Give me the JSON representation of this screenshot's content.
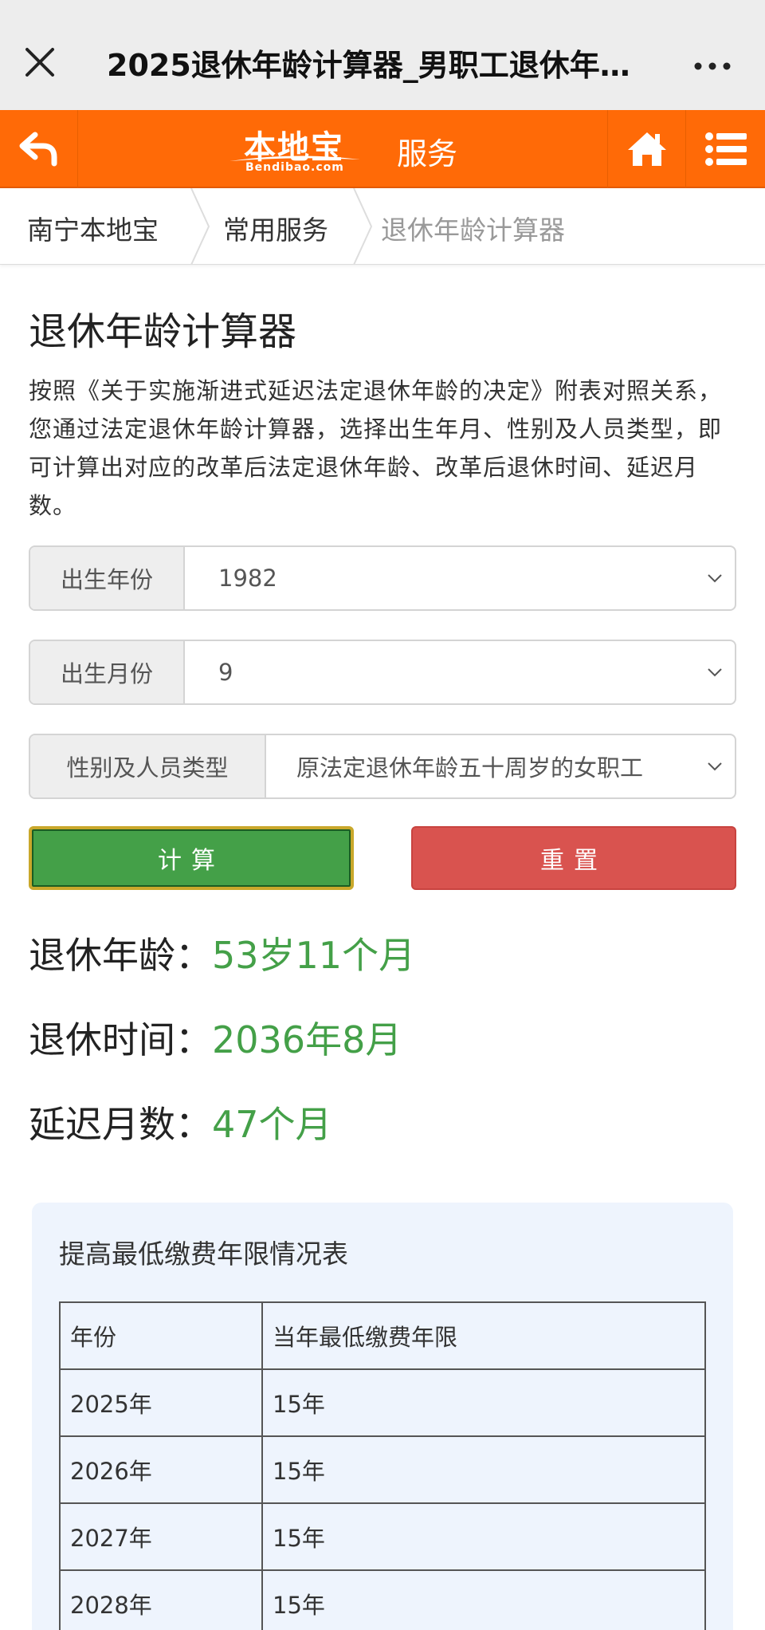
{
  "window": {
    "title": "2025退休年龄计算器_男职工退休年…"
  },
  "nav": {
    "logo_text": "本地宝",
    "logo_subtext": "Bendibao.com",
    "section": "服务",
    "accent_color": "#ff6a07"
  },
  "breadcrumb": {
    "items": [
      "南宁本地宝",
      "常用服务",
      "退休年龄计算器"
    ]
  },
  "page": {
    "heading": "退休年龄计算器",
    "description": "按照《关于实施渐进式延迟法定退休年龄的决定》附表对照关系，您通过法定退休年龄计算器，选择出生年月、性别及人员类型，即可计算出对应的改革后法定退休年龄、改革后退休时间、延迟月数。"
  },
  "form": {
    "birth_year": {
      "label": "出生年份",
      "value": "1982"
    },
    "birth_month": {
      "label": "出生月份",
      "value": "9"
    },
    "person_type": {
      "label": "性别及人员类型",
      "value": "原法定退休年龄五十周岁的女职工"
    }
  },
  "buttons": {
    "calculate": "计算",
    "reset": "重置"
  },
  "results": {
    "retire_age_label": "退休年龄：",
    "retire_age_value": "53岁11个月",
    "retire_time_label": "退休时间：",
    "retire_time_value": "2036年8月",
    "delay_label": "延迟月数：",
    "delay_value": "47个月",
    "value_color": "#44a048"
  },
  "contribution_table": {
    "title": "提高最低缴费年限情况表",
    "headers": [
      "年份",
      "当年最低缴费年限"
    ],
    "rows": [
      [
        "2025年",
        "15年"
      ],
      [
        "2026年",
        "15年"
      ],
      [
        "2027年",
        "15年"
      ],
      [
        "2028年",
        "15年"
      ]
    ]
  }
}
